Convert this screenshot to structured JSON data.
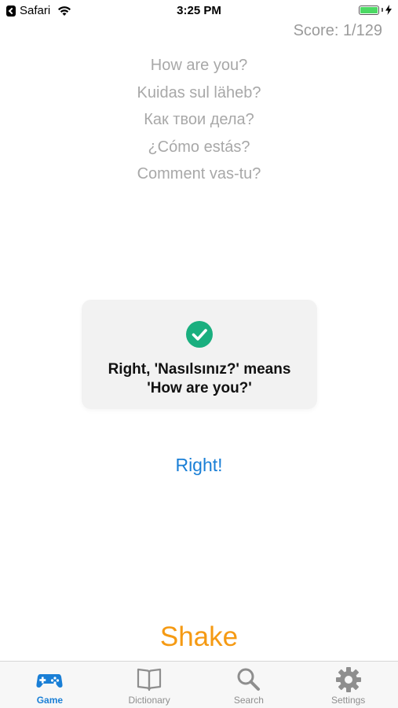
{
  "status_bar": {
    "back_app": "Safari",
    "time": "3:25 PM",
    "battery_color": "#4cd964"
  },
  "score": "Score: 1/129",
  "phrases": [
    "How are you?",
    "Kuidas sul läheb?",
    "Как твои дела?",
    "¿Cómo estás?",
    "Comment vas-tu?"
  ],
  "toast": {
    "icon": "checkmark-circle-icon",
    "line1": "Right, 'Nasılsınız?' means",
    "line2": "'How are you?'",
    "accent": "#1aaf7f"
  },
  "result_label": "Right!",
  "shake_label": "Shake",
  "tabs": [
    {
      "label": "Game",
      "icon": "gamepad-icon",
      "active": true
    },
    {
      "label": "Dictionary",
      "icon": "book-icon",
      "active": false
    },
    {
      "label": "Search",
      "icon": "search-icon",
      "active": false
    },
    {
      "label": "Settings",
      "icon": "gear-icon",
      "active": false
    }
  ],
  "colors": {
    "accent_blue": "#1a7fd6",
    "shake_orange": "#f59a13",
    "phrase_gray": "#a8a8a8"
  }
}
